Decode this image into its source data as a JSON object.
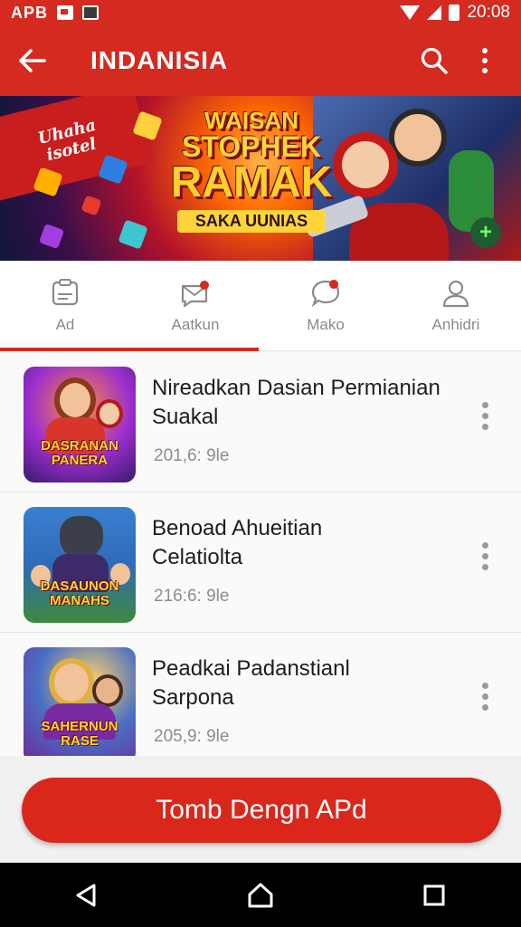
{
  "status_bar": {
    "carrier": "APB",
    "time": "20:08"
  },
  "app_bar": {
    "title": "INDANISIA"
  },
  "banner": {
    "ribbon_text": "Uhaha\nisotel",
    "title_line1": "WAISAN",
    "title_line2": "STOPHEK",
    "title_line3": "RAMAK",
    "subtitle": "SAKA UUNIAS"
  },
  "tabs": [
    {
      "label": "Ad",
      "icon": "id-card-icon"
    },
    {
      "label": "Aatkun",
      "icon": "message-icon"
    },
    {
      "label": "Mako",
      "icon": "chat-bubble-icon"
    },
    {
      "label": "Anhidri",
      "icon": "person-icon"
    }
  ],
  "list": [
    {
      "title": "Nireadkan Dasian Permianian\nSuakal",
      "meta": "201,6: 9le",
      "thumb_label": "DASRANAN\nPANERA",
      "thumb_colors": [
        "#5b2ea8",
        "#d9362b"
      ]
    },
    {
      "title": "Benoad Ahueitian\nCelatiolta",
      "meta": "216:6: 9le",
      "thumb_label": "DASAUNON\nMANAHS",
      "thumb_colors": [
        "#2f6bb7",
        "#3d8a3b"
      ]
    },
    {
      "title": "Peadkai Padanstianl\nSarpona",
      "meta": "205,9: 9le",
      "thumb_label": "SAHERNUN\nRASE",
      "thumb_colors": [
        "#4a6fc4",
        "#6a2a9a"
      ]
    }
  ],
  "cta": {
    "label": "Tomb Dengn APd"
  },
  "colors": {
    "primary": "#d42a1f",
    "background": "#fafafa"
  }
}
